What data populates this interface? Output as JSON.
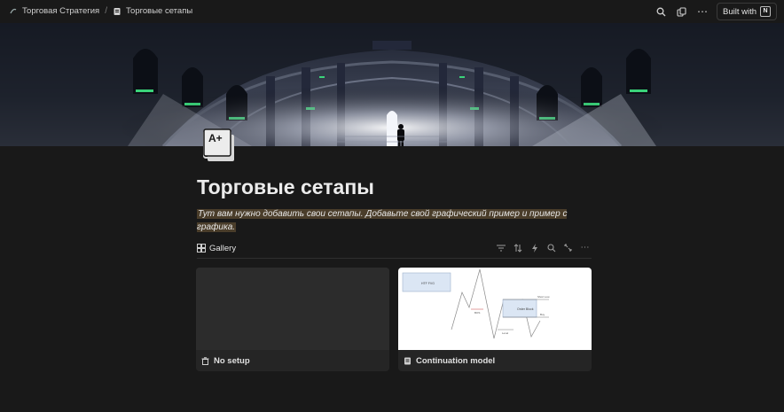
{
  "breadcrumb": {
    "parent": "Торговая Стратегия",
    "current": "Торговые сетапы",
    "separator": "/"
  },
  "topbar": {
    "built_with_label": "Built with",
    "icons": [
      "search-icon",
      "duplicate-icon",
      "more-icon",
      "notion-logo-icon"
    ]
  },
  "page": {
    "icon": "A+",
    "title": "Торговые сетапы",
    "description": "Тут вам нужно добавить свои сетапы. Добавьте свой графический пример и пример с графика."
  },
  "view": {
    "tab_label": "Gallery",
    "tools": [
      "filter-icon",
      "sort-icon",
      "automation-icon",
      "search-icon",
      "expand-icon",
      "more-icon"
    ]
  },
  "gallery": [
    {
      "name": "No setup",
      "icon": "trash-icon"
    },
    {
      "name": "Continuation model",
      "icon": "page-icon"
    }
  ],
  "chart_labels": {
    "box1": "HTF FVG",
    "box2": "Order Block",
    "label_high": "Short Low",
    "label_low": "Buy",
    "label_a": "BOS",
    "label_b": "Level"
  },
  "colors": {
    "background": "#191919",
    "highlight": "#4a3d2a",
    "accent_green": "#3ad37a"
  }
}
